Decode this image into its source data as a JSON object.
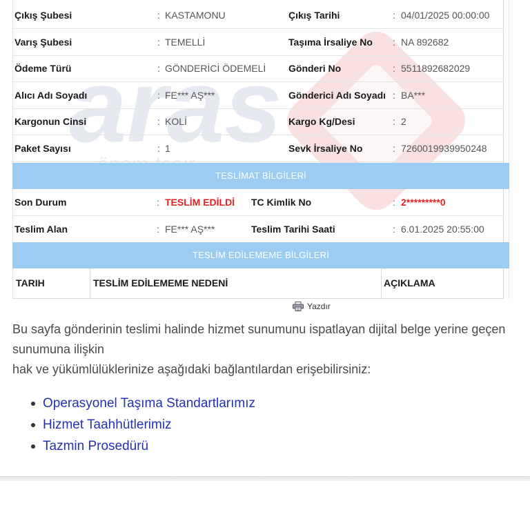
{
  "details": [
    {
      "l1": "Çıkış Şubesi",
      "v1": "KASTAMONU",
      "l2": "Çıkış Tarihi",
      "v2": "04/01/2025 00:00:00"
    },
    {
      "l1": "Varış Şubesi",
      "v1": "TEMELLİ",
      "l2": "Taşıma İrsaliye No",
      "v2": "NA 892682"
    },
    {
      "l1": "Ödeme Türü",
      "v1": "GÖNDERİCİ ÖDEMELİ",
      "l2": "Gönderi No",
      "v2": "5511892682029"
    },
    {
      "l1": "Alıcı Adı Soyadı",
      "v1": "FE*** AŞ***",
      "l2": "Gönderici Adı Soyadı",
      "v2": "BA***"
    },
    {
      "l1": "Kargonun Cinsi",
      "v1": "KOLİ",
      "l2": "Kargo Kg/Desi",
      "v2": "2"
    },
    {
      "l1": "Paket Sayısı",
      "v1": "1",
      "l2": "Sevk İrsaliye No",
      "v2": "7260019939950248"
    }
  ],
  "colon": ":",
  "delivery": {
    "title": "TESLİMAT BİLGİLERİ",
    "rows": [
      {
        "l1": "Son Durum",
        "v1": "TESLİM EDİLDİ",
        "l2": "TC Kimlik No",
        "v2": "2*********0"
      },
      {
        "l1": "Teslim Alan",
        "v1": "FE*** AŞ***",
        "l2": "Teslim Tarihi Saati",
        "v2": "6.01.2025 20:55:00"
      }
    ]
  },
  "failed": {
    "title": "TESLİM EDİLEMEME BİLGİLERİ",
    "columns": [
      "TARIH",
      "TESLİM EDİLEMEME NEDENİ",
      "AÇIKLAMA"
    ]
  },
  "print_label": "Yazdır",
  "paragraph": [
    "Bu sayfa gönderinin teslimi halinde hizmet sunumunu ispatlayan dijital belge yerine geçen",
    "sunumuna ilişkin",
    "hak ve yükümlülüklerinize aşağıdaki bağlantılardan erişebilirsiniz:"
  ],
  "links": [
    "Operasyonel Taşıma Standartlarımız",
    "Hizmet Taahhütlerimiz",
    "Tazmin Prosedürü"
  ],
  "colors": {
    "section_bg": "#9cccf2",
    "status_red": "#e32222",
    "link_blue": "#2530b5",
    "watermark": "#e04a4a"
  },
  "watermark_logo": {
    "brand": "aras",
    "tagline": "önem taşır"
  }
}
